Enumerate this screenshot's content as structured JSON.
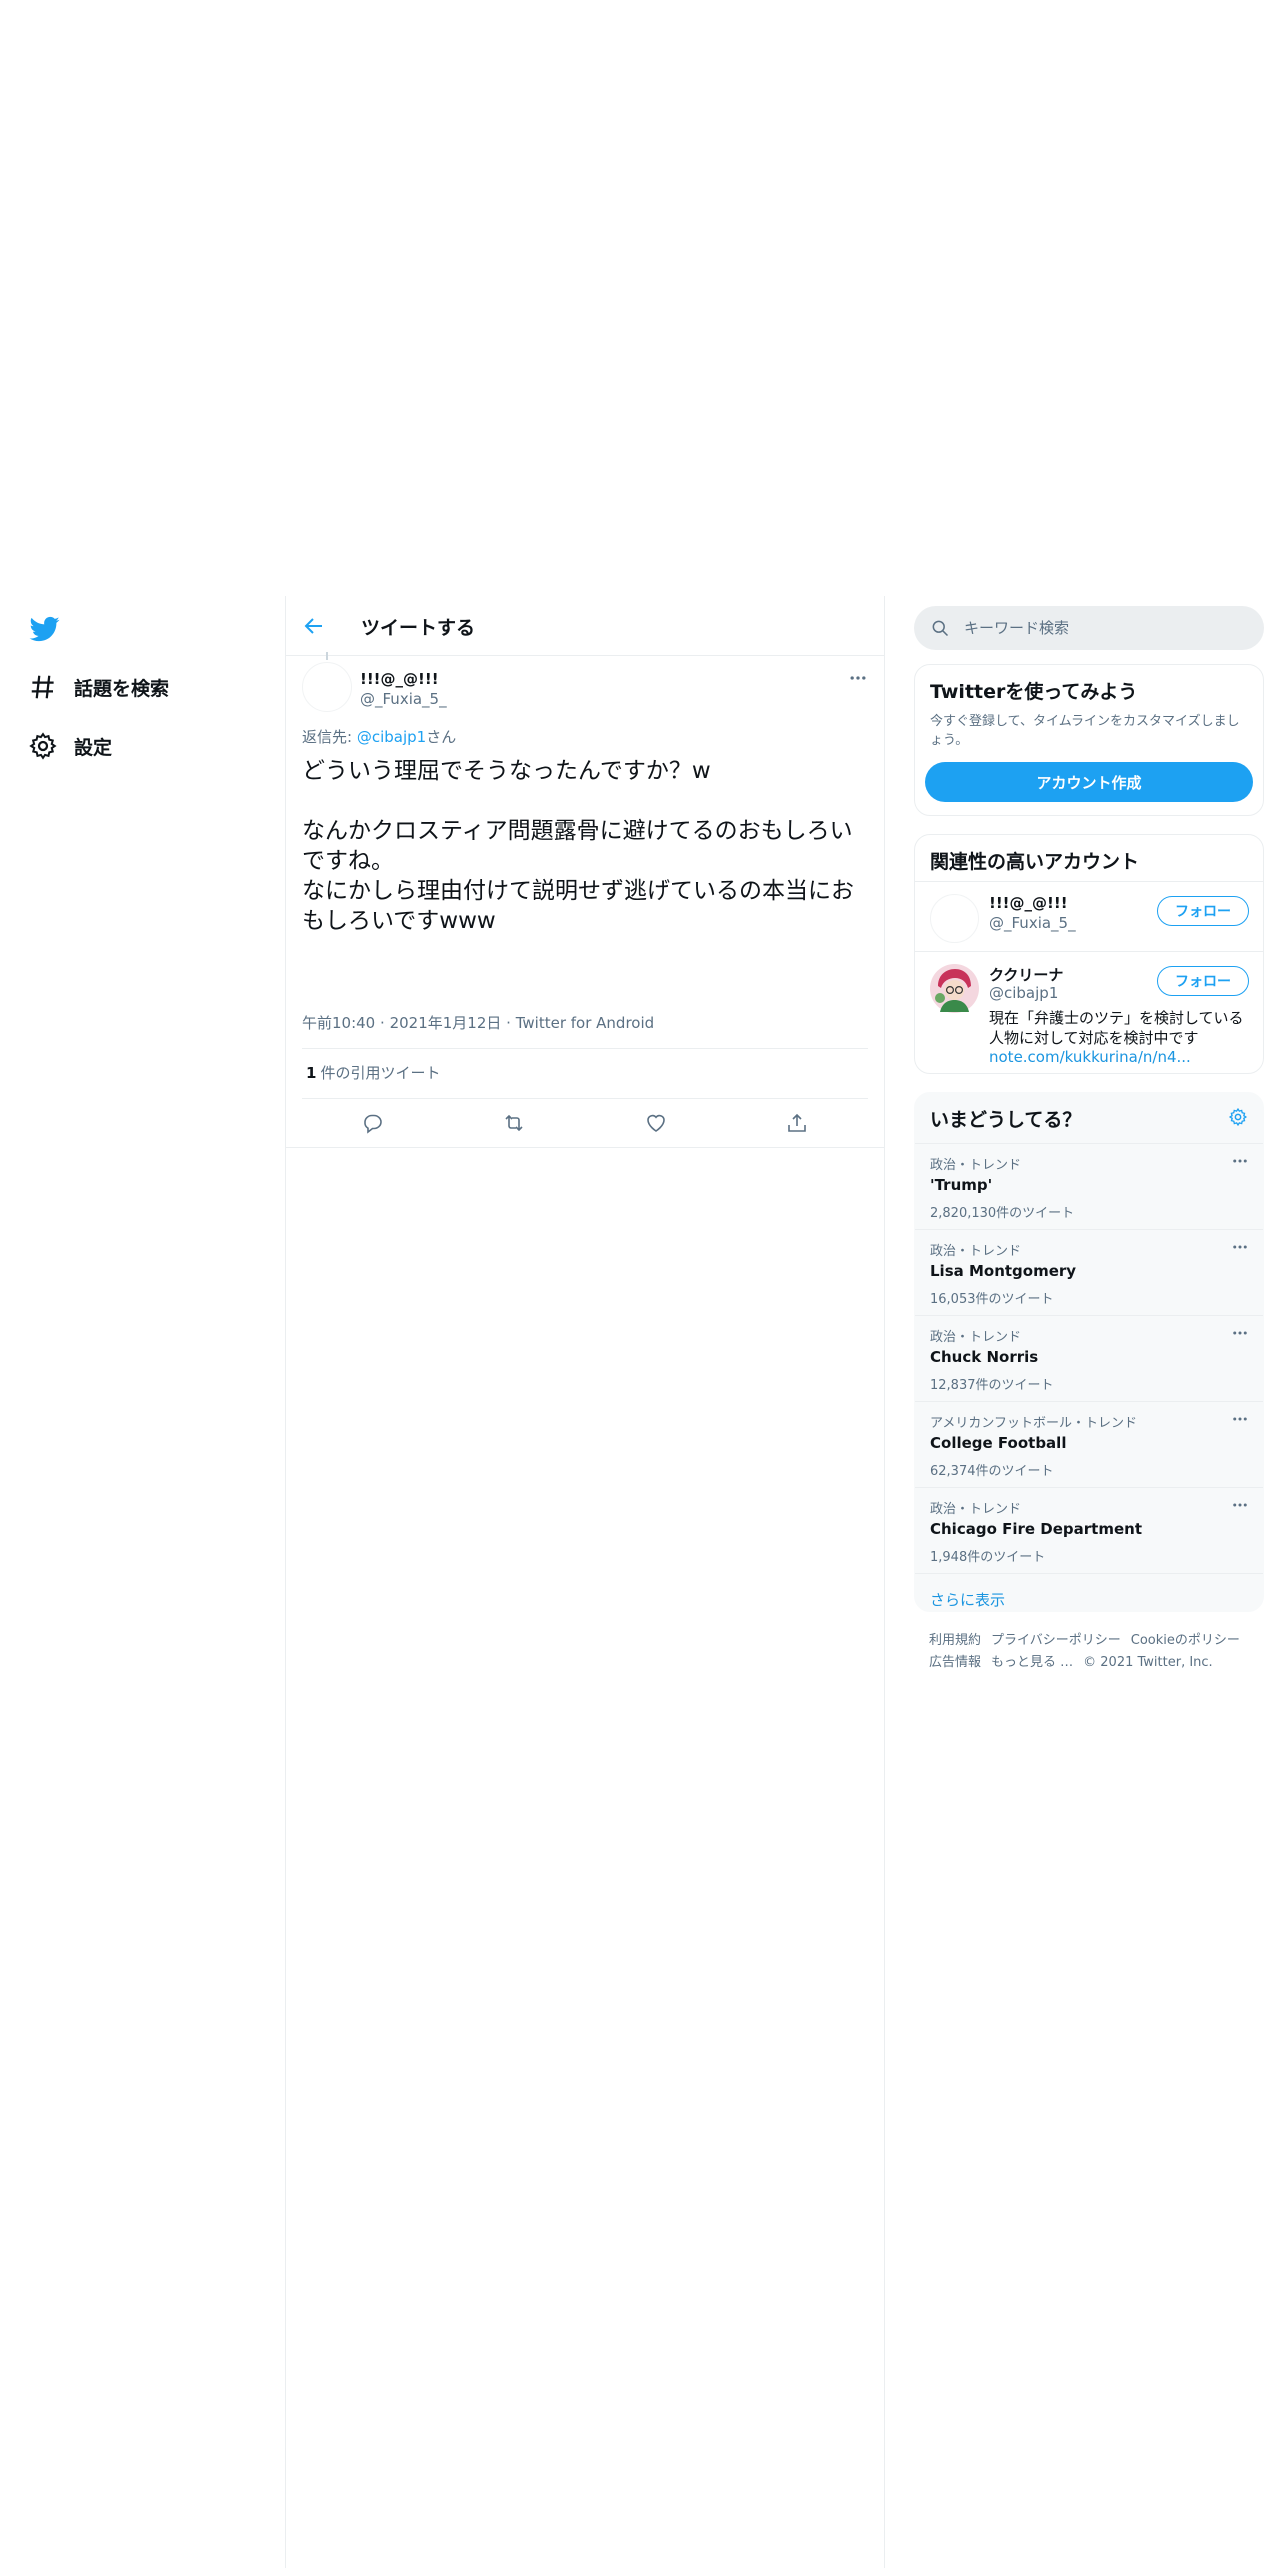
{
  "nav": {
    "items": [
      {
        "label": "話題を検索",
        "icon": "hashtag-icon"
      },
      {
        "label": "設定",
        "icon": "gear-icon"
      }
    ]
  },
  "main": {
    "header_title": "ツイートする",
    "tweet": {
      "name": "!!!@_@!!!",
      "handle": "@_Fuxia_5_",
      "reply_prefix": "返信先: ",
      "reply_handle": "@cibajp1",
      "reply_suffix": "さん",
      "text": "どういう理屈でそうなったんですか？w\n\nなんかクロスティア問題露骨に避けてるのおもしろいですね。\nなにかしら理由付けて説明せず逃げているの本当におもしろいですwww",
      "time": "午前10:40",
      "date": "2021年1月12日",
      "source": "Twitter for Android",
      "quote_count": "1",
      "quote_label": "件の引用ツイート"
    }
  },
  "right": {
    "search_placeholder": "キーワード検索",
    "signup": {
      "title": "Twitterを使ってみよう",
      "desc": "今すぐ登録して、タイムラインをカスタマイズしましょう。",
      "button": "アカウント作成"
    },
    "related": {
      "title": "関連性の高いアカウント",
      "accounts": [
        {
          "name": "!!!@_@!!!",
          "handle": "@_Fuxia_5_",
          "follow": "フォロー"
        },
        {
          "name": "ククリーナ",
          "handle": "@cibajp1",
          "follow": "フォロー",
          "bio": "現在「弁護士のツテ」を検討している人物に対して対応を検討中です",
          "link": "note.com/kukkurina/n/n4..."
        }
      ]
    },
    "trends": {
      "title": "いまどうしてる？",
      "items": [
        {
          "context": "政治・トレンド",
          "name": "'Trump'",
          "count": "2,820,130件のツイート"
        },
        {
          "context": "政治・トレンド",
          "name": "Lisa Montgomery",
          "count": "16,053件のツイート"
        },
        {
          "context": "政治・トレンド",
          "name": "Chuck Norris",
          "count": "12,837件のツイート"
        },
        {
          "context": "アメリカンフットボール・トレンド",
          "name": "College Football",
          "count": "62,374件のツイート"
        },
        {
          "context": "政治・トレンド",
          "name": "Chicago Fire Department",
          "count": "1,948件のツイート"
        }
      ],
      "show_more": "さらに表示"
    },
    "footer": {
      "links": [
        "利用規約",
        "プライバシーポリシー",
        "Cookieのポリシー",
        "広告情報",
        "もっと見る …"
      ],
      "copyright": "© 2021 Twitter, Inc."
    }
  },
  "colors": {
    "accent": "#1da1f2",
    "text": "#0f1419",
    "muted": "#5b7083",
    "border": "#ebeef0"
  }
}
